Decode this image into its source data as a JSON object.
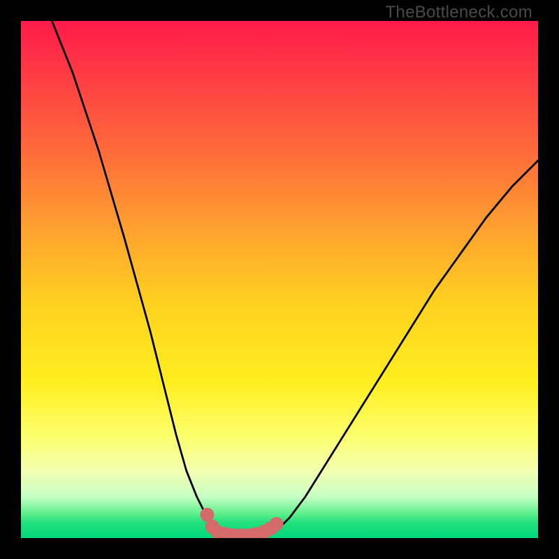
{
  "brand": "TheBottleneck.com",
  "chart_data": {
    "type": "line",
    "title": "",
    "xlabel": "",
    "ylabel": "",
    "xlim": [
      0,
      100
    ],
    "ylim": [
      0,
      100
    ],
    "series": [
      {
        "name": "curve-left",
        "x": [
          6,
          10,
          15,
          20,
          25,
          28,
          30,
          32,
          34,
          36,
          37,
          38
        ],
        "y": [
          100,
          90,
          75,
          58,
          40,
          28,
          20,
          13,
          8,
          4,
          2,
          1
        ]
      },
      {
        "name": "curve-right",
        "x": [
          48,
          50,
          52,
          55,
          60,
          65,
          70,
          75,
          80,
          85,
          90,
          95,
          100
        ],
        "y": [
          1,
          2,
          4,
          8,
          16,
          24,
          32,
          40,
          48,
          55,
          62,
          68,
          73
        ]
      },
      {
        "name": "valley-floor",
        "x": [
          38,
          40,
          42,
          44,
          46,
          48
        ],
        "y": [
          1,
          0.5,
          0.3,
          0.3,
          0.5,
          1
        ]
      }
    ],
    "markers": {
      "name": "highlight-dots",
      "color": "#d46a6a",
      "points": [
        {
          "x": 36,
          "y": 4.5
        },
        {
          "x": 37,
          "y": 2.2
        },
        {
          "x": 38,
          "y": 1.2
        },
        {
          "x": 39.5,
          "y": 0.8
        },
        {
          "x": 41,
          "y": 0.55
        },
        {
          "x": 42.5,
          "y": 0.5
        },
        {
          "x": 44,
          "y": 0.55
        },
        {
          "x": 45.5,
          "y": 0.8
        },
        {
          "x": 47.2,
          "y": 1.3
        },
        {
          "x": 48.4,
          "y": 1.9
        },
        {
          "x": 49.4,
          "y": 2.7
        }
      ]
    }
  }
}
